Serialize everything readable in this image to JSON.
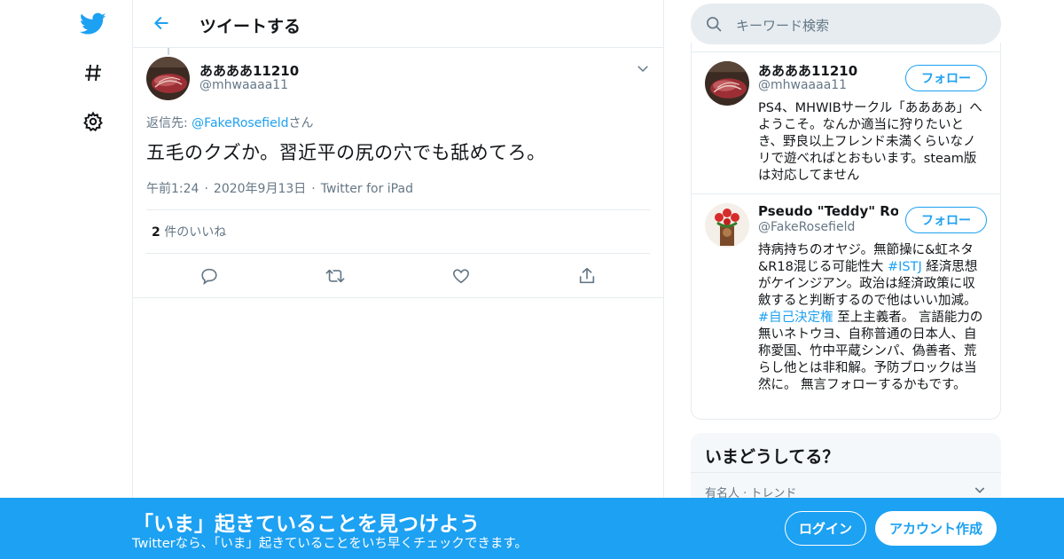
{
  "nav": {
    "logo": "twitter-bird-icon",
    "explore": "hashtag-icon",
    "settings": "gear-icon"
  },
  "header": {
    "title": "ツイートする"
  },
  "tweet": {
    "author_name": "ああああ11210",
    "author_handle": "@mhwaaaa11",
    "reply_prefix": "返信先: ",
    "reply_handle": "@FakeRosefield",
    "reply_suffix": "さん",
    "text": "五毛のクズか。習近平の尻の穴でも舐めてろ。",
    "time": "午前1:24",
    "date": "2020年9月13日",
    "source": "Twitter for iPad",
    "likes_count": "2",
    "likes_label": " 件のいいね"
  },
  "search": {
    "placeholder": "キーワード検索"
  },
  "users": [
    {
      "name": "ああああ11210",
      "handle": "@mhwaaaa11",
      "follow_label": "フォロー",
      "bio": "PS4、MHWIBサークル「ああああ」へようこそ。なんか適当に狩りたいとき、野良以上フレンド未満くらいなノリで遊べればとおもいます。steam版は対応してません"
    },
    {
      "name": "Pseudo \"Teddy\" Rose...",
      "handle": "@FakeRosefield",
      "follow_label": "フォロー",
      "bio_part1": "持病持ちのオヤジ。無節操に&虹ネタ&R18混じる可能性大 ",
      "bio_tag1": "#ISTJ",
      "bio_part2": " 経済思想がケインジアン。政治は経済政策に収斂すると判断するので他はいい加減。",
      "bio_tag2": "#自己決定権",
      "bio_part3": " 至上主義者。 言語能力の無いネトウヨ、自称普通の日本人、自称愛国、竹中平蔵シンパ、偽善者、荒らし他とは非和解。予防ブロックは当然に。 無言フォローするかもです。"
    }
  ],
  "trends": {
    "title": "いまどうしてる？",
    "meta": "有名人 · トレンド"
  },
  "banner": {
    "title": "「いま」起きていることを見つけよう",
    "subtitle": "Twitterなら、「いま」起きていることをいち早くチェックできます。",
    "login_label": "ログイン",
    "signup_label": "アカウント作成"
  },
  "colors": {
    "accent": "#1da1f2",
    "text": "#14171a",
    "secondary": "#657786",
    "border": "#e6ecf0"
  }
}
